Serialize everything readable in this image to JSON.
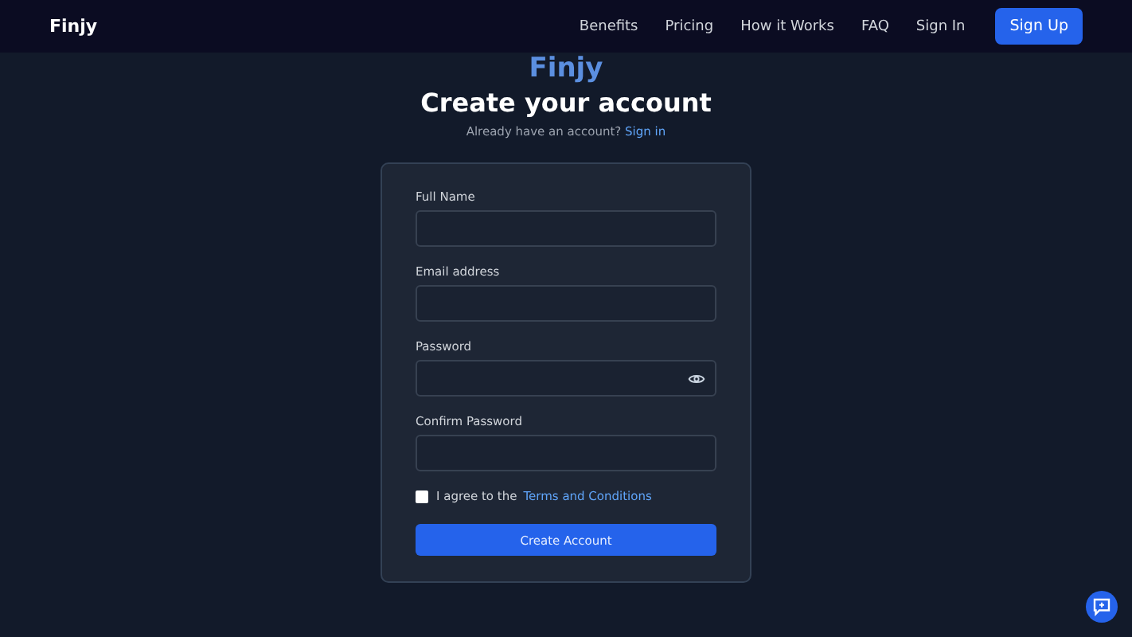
{
  "nav": {
    "brand": "Finjy",
    "links": [
      {
        "label": "Benefits"
      },
      {
        "label": "Pricing"
      },
      {
        "label": "How it Works"
      },
      {
        "label": "FAQ"
      },
      {
        "label": "Sign In"
      }
    ],
    "cta": "Sign Up"
  },
  "logo": "Finjy",
  "heading": "Create your account",
  "subheading": {
    "text": "Already have an account?",
    "link": "Sign in"
  },
  "form": {
    "fields": [
      {
        "label": "Full Name",
        "kind": "text"
      },
      {
        "label": "Email address",
        "kind": "text"
      },
      {
        "label": "Password",
        "kind": "password"
      },
      {
        "label": "Confirm Password",
        "kind": "text"
      }
    ],
    "agree": {
      "checked": false,
      "text": "I agree to the",
      "link": "Terms and Conditions"
    },
    "submit": "Create Account"
  }
}
